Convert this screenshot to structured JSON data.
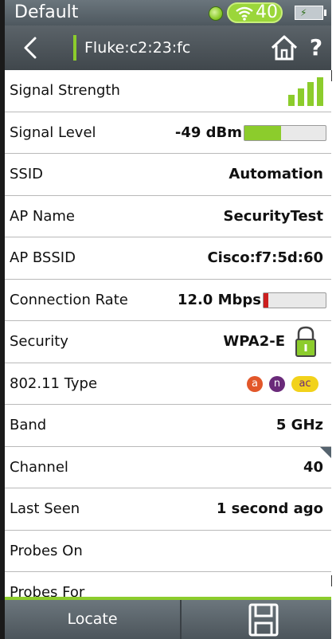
{
  "status_bar": {
    "profile_name": "Default",
    "wifi_channel_count": "40",
    "icons": [
      "status-indicator-icon",
      "wifi-icon",
      "battery-charging-icon"
    ]
  },
  "nav_bar": {
    "title": "Fluke:c2:23:fc",
    "icons": [
      "back-icon",
      "home-icon",
      "help-icon"
    ],
    "help_label": "?"
  },
  "rows": {
    "signal_strength": {
      "label": "Signal Strength",
      "bars": 4,
      "bars_max": 4
    },
    "signal_level": {
      "label": "Signal Level",
      "value": "-49 dBm",
      "level_fraction": 0.45
    },
    "ssid": {
      "label": "SSID",
      "value": "Automation"
    },
    "ap_name": {
      "label": "AP Name",
      "value": "SecurityTest"
    },
    "ap_bssid": {
      "label": "AP BSSID",
      "value": "Cisco:f7:5d:60"
    },
    "connection_rate": {
      "label": "Connection Rate",
      "value": "12.0 Mbps",
      "level_fraction": 0.08
    },
    "security": {
      "label": "Security",
      "value": "WPA2-E",
      "icon": "lock-open-icon"
    },
    "type_80211": {
      "label": "802.11 Type",
      "badges": [
        "a",
        "n",
        "ac"
      ]
    },
    "band": {
      "label": "Band",
      "value": "5 GHz"
    },
    "channel": {
      "label": "Channel",
      "value": "40"
    },
    "last_seen": {
      "label": "Last Seen",
      "value": "1 second ago"
    },
    "probes_on": {
      "label": "Probes On",
      "value": ""
    },
    "probes_for": {
      "label": "Probes For",
      "value": ""
    }
  },
  "bottom_bar": {
    "locate_label": "Locate",
    "save_icon": "save-icon"
  },
  "colors": {
    "accent_green": "#8ccc2c",
    "bar_red": "#cc1f1f",
    "badge_a": "#e2572a",
    "badge_n": "#6a2a7a",
    "badge_ac": "#f2d21b"
  }
}
